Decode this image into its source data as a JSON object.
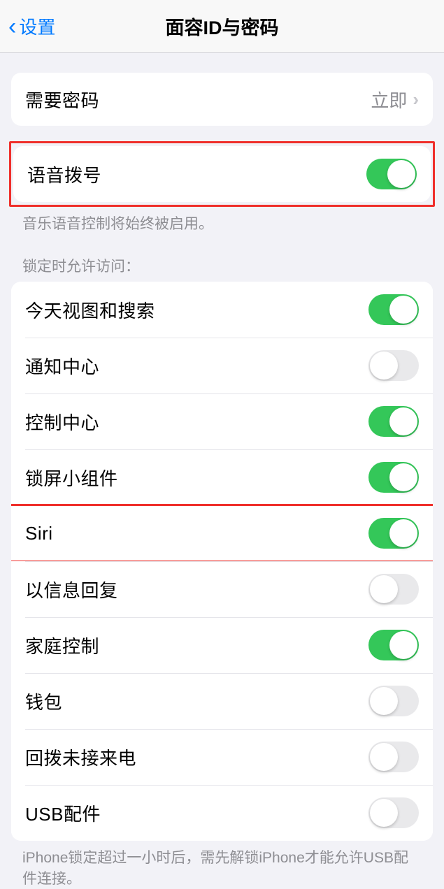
{
  "header": {
    "back_label": "设置",
    "title": "面容ID与密码"
  },
  "passcode_row": {
    "label": "需要密码",
    "value": "立即"
  },
  "voice_dial": {
    "label": "语音拨号",
    "on": true,
    "footer": "音乐语音控制将始终被启用。"
  },
  "lock_section": {
    "header": "锁定时允许访问：",
    "items": [
      {
        "label": "今天视图和搜索",
        "on": true,
        "highlight": false
      },
      {
        "label": "通知中心",
        "on": false,
        "highlight": false
      },
      {
        "label": "控制中心",
        "on": true,
        "highlight": false
      },
      {
        "label": "锁屏小组件",
        "on": true,
        "highlight": false
      },
      {
        "label": "Siri",
        "on": true,
        "highlight": true
      },
      {
        "label": "以信息回复",
        "on": false,
        "highlight": false
      },
      {
        "label": "家庭控制",
        "on": true,
        "highlight": false
      },
      {
        "label": "钱包",
        "on": false,
        "highlight": false
      },
      {
        "label": "回拨未接来电",
        "on": false,
        "highlight": false
      },
      {
        "label": "USB配件",
        "on": false,
        "highlight": false
      }
    ],
    "footer": "iPhone锁定超过一小时后，需先解锁iPhone才能允许USB配件连接。"
  }
}
